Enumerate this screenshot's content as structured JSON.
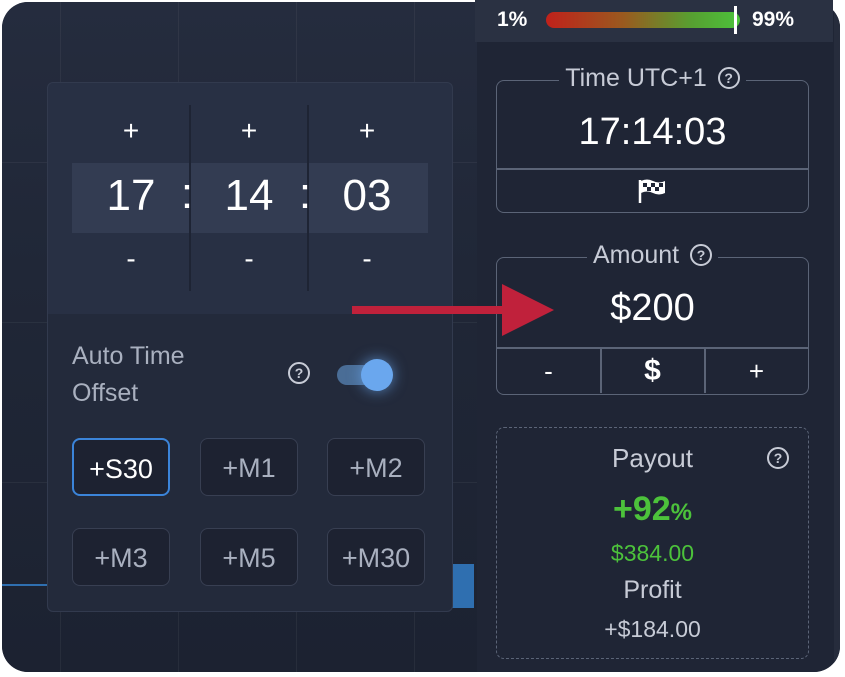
{
  "sentiment": {
    "left_label": "1%",
    "right_label": "99%",
    "colors": {
      "low": "#c0211b",
      "high": "#4cc23b"
    }
  },
  "time": {
    "legend": "Time UTC+1",
    "value": "17:14:03",
    "flag_icon": "flag-icon"
  },
  "amount": {
    "legend": "Amount",
    "value": "$200",
    "minus": "-",
    "currency": "$",
    "plus": "+"
  },
  "payout": {
    "label": "Payout",
    "percent": "+92",
    "percent_sign": "%",
    "amount": "$384.00",
    "profit_label": "Profit",
    "profit_value": "+$184.00",
    "accent": "#4cc23b"
  },
  "time_picker": {
    "plus": "+",
    "minus": "-",
    "separator": ":",
    "hours": "17",
    "minutes": "14",
    "seconds": "03"
  },
  "auto_time_offset": {
    "label_line1": "Auto Time",
    "label_line2": "Offset",
    "enabled": true,
    "options": [
      "+S30",
      "+M1",
      "+M2",
      "+M3",
      "+M5",
      "+M30"
    ],
    "selected": "+S30"
  },
  "help_icon": "?",
  "colors": {
    "background": "#1b2131",
    "accent_blue": "#3b84d9",
    "arrow": "#c0213b"
  }
}
